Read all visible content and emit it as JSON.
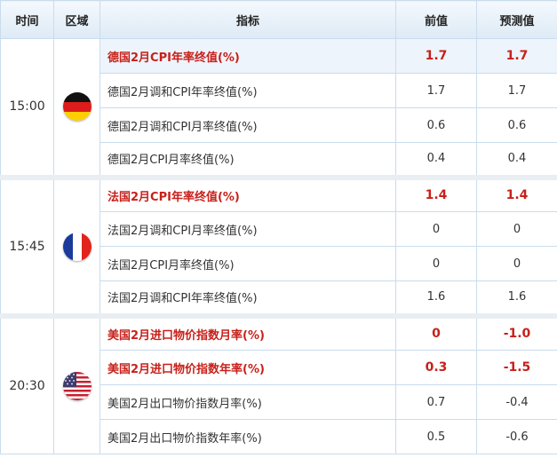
{
  "headers": {
    "time": "时间",
    "region": "区域",
    "indicator": "指标",
    "previous": "前值",
    "forecast": "预测值"
  },
  "groups": [
    {
      "time": "15:00",
      "flag_icon": "germany-flag-icon",
      "rows": [
        {
          "name": "德国2月CPI年率终值(%)",
          "previous": "1.7",
          "forecast": "1.7",
          "highlight": true
        },
        {
          "name": "德国2月调和CPI年率终值(%)",
          "previous": "1.7",
          "forecast": "1.7",
          "highlight": false
        },
        {
          "name": "德国2月调和CPI月率终值(%)",
          "previous": "0.6",
          "forecast": "0.6",
          "highlight": false
        },
        {
          "name": "德国2月CPI月率终值(%)",
          "previous": "0.4",
          "forecast": "0.4",
          "highlight": false
        }
      ]
    },
    {
      "time": "15:45",
      "flag_icon": "france-flag-icon",
      "rows": [
        {
          "name": "法国2月CPI年率终值(%)",
          "previous": "1.4",
          "forecast": "1.4",
          "highlight": true
        },
        {
          "name": "法国2月调和CPI月率终值(%)",
          "previous": "0",
          "forecast": "0",
          "highlight": false
        },
        {
          "name": "法国2月CPI月率终值(%)",
          "previous": "0",
          "forecast": "0",
          "highlight": false
        },
        {
          "name": "法国2月调和CPI年率终值(%)",
          "previous": "1.6",
          "forecast": "1.6",
          "highlight": false
        }
      ]
    },
    {
      "time": "20:30",
      "flag_icon": "usa-flag-icon",
      "rows": [
        {
          "name": "美国2月进口物价指数月率(%)",
          "previous": "0",
          "forecast": "-1.0",
          "highlight": true
        },
        {
          "name": "美国2月进口物价指数年率(%)",
          "previous": "0.3",
          "forecast": "-1.5",
          "highlight": true
        },
        {
          "name": "美国2月出口物价指数月率(%)",
          "previous": "0.7",
          "forecast": "-0.4",
          "highlight": false
        },
        {
          "name": "美国2月出口物价指数年率(%)",
          "previous": "0.5",
          "forecast": "-0.6",
          "highlight": false
        }
      ]
    }
  ],
  "colors": {
    "highlight_text": "#c8201a",
    "header_bg": "#ddeaf5",
    "border": "#c9dced",
    "shade_row": "#eef4fb"
  }
}
